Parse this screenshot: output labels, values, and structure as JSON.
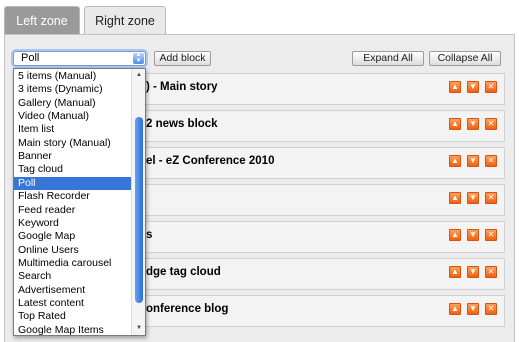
{
  "tabs": [
    {
      "label": "Left zone",
      "active": true
    },
    {
      "label": "Right zone",
      "active": false
    }
  ],
  "toolbar": {
    "block_type_value": "Poll",
    "add_label": "Add block",
    "expand_label": "Expand All",
    "collapse_label": "Collapse All"
  },
  "dropdown": {
    "options": [
      "5 items (Manual)",
      "3 items (Dynamic)",
      "Gallery (Manual)",
      "Video (Manual)",
      "Item list",
      "Main story (Manual)",
      "Banner",
      "Tag cloud",
      "Poll",
      "Flash Recorder",
      "Feed reader",
      "Keyword",
      "Google Map",
      "Online Users",
      "Multimedia carousel",
      "Search",
      "Advertisement",
      "Latest content",
      "Top Rated",
      "Google Map Items"
    ],
    "selected_index": 8
  },
  "blocks": [
    {
      "title_visible": ") - Main story"
    },
    {
      "title_visible": "2 news block"
    },
    {
      "title_visible": "el - eZ Conference 2010"
    },
    {
      "title_visible": ""
    },
    {
      "title_visible": "s"
    },
    {
      "title_visible": "dge tag cloud"
    },
    {
      "title_visible": "onference blog"
    }
  ],
  "controls": {
    "up_icon": "up-arrow-icon",
    "down_icon": "down-arrow-icon",
    "delete_icon": "close-icon"
  },
  "colors": {
    "tab_active_bg": "#9a9a9a",
    "selection": "#3875d7",
    "control_orange": "#f47a2a"
  }
}
